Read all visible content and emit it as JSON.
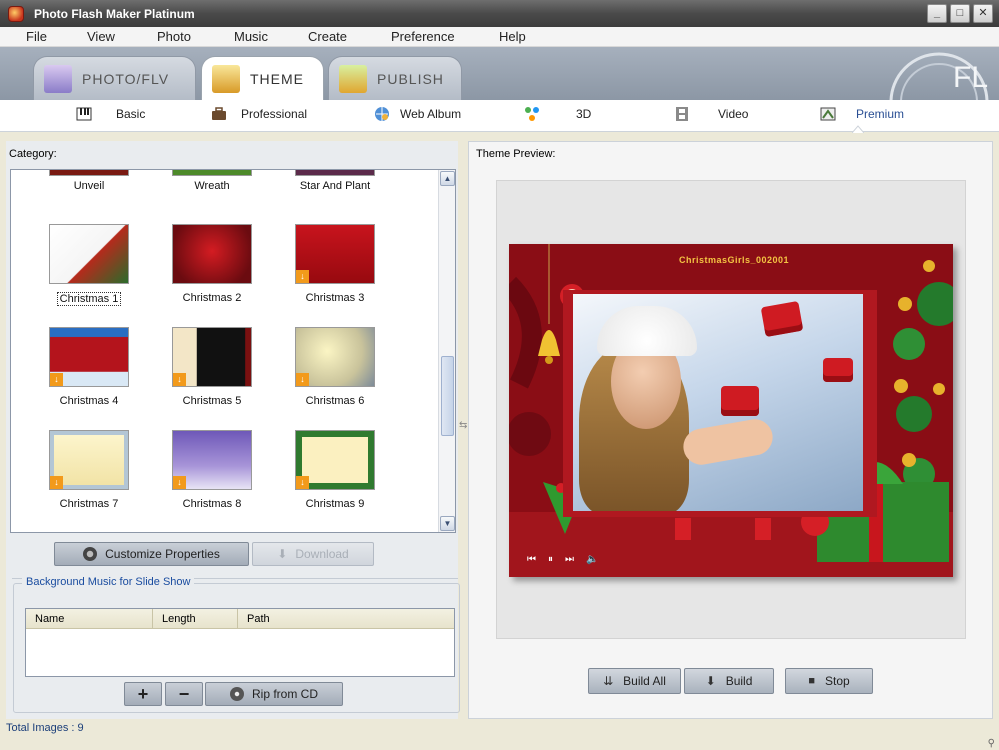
{
  "window": {
    "title": "Photo Flash Maker Platinum",
    "minimize": "_",
    "maximize": "□",
    "close": "✕"
  },
  "menu": [
    "File",
    "View",
    "Photo",
    "Music",
    "Create",
    "Preference",
    "Help"
  ],
  "main_tabs": [
    {
      "label": "PHOTO/FLV",
      "active": false
    },
    {
      "label": "THEME",
      "active": true
    },
    {
      "label": "PUBLISH",
      "active": false
    }
  ],
  "brand_text": "FL",
  "sub_tabs": [
    {
      "label": "Basic",
      "icon": "piano-icon"
    },
    {
      "label": "Professional",
      "icon": "briefcase-icon"
    },
    {
      "label": "Web Album",
      "icon": "globe-icon"
    },
    {
      "label": "3D",
      "icon": "molecule-icon"
    },
    {
      "label": "Video",
      "icon": "film-icon"
    },
    {
      "label": "Premium",
      "icon": "premium-icon",
      "active": true
    }
  ],
  "category": {
    "label": "Category:",
    "top_row": [
      "Unveil",
      "Wreath",
      "Star And Plant"
    ],
    "themes": [
      {
        "name": "Christmas 1",
        "selected": true,
        "download": false
      },
      {
        "name": "Christmas 2",
        "download": false
      },
      {
        "name": "Christmas 3",
        "download": true
      },
      {
        "name": "Christmas 4",
        "download": true
      },
      {
        "name": "Christmas 5",
        "download": true
      },
      {
        "name": "Christmas 6",
        "download": true
      },
      {
        "name": "Christmas 7",
        "download": true
      },
      {
        "name": "Christmas 8",
        "download": true
      },
      {
        "name": "Christmas 9",
        "download": true
      }
    ]
  },
  "buttons": {
    "customize": "Customize Properties",
    "download": "Download",
    "add": "+",
    "remove": "−",
    "rip": "Rip from CD",
    "build_all": "Build All",
    "build": "Build",
    "stop": "Stop"
  },
  "music": {
    "legend": "Background Music for Slide Show",
    "columns": [
      "Name",
      "Length",
      "Path"
    ]
  },
  "preview": {
    "label": "Theme Preview:",
    "stage_title": "ChristmasGirls_002001"
  },
  "status": {
    "text": "Total Images : 9"
  }
}
